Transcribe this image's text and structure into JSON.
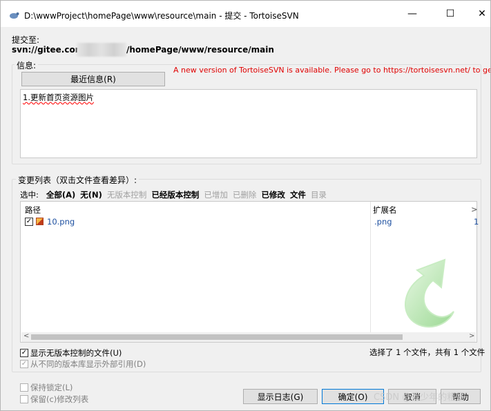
{
  "window": {
    "title": "D:\\wwwProject\\homePage\\www\\resource\\main - 提交 - TortoiseSVN",
    "minimize_glyph": "—",
    "maximize_glyph": "☐",
    "close_glyph": "✕"
  },
  "commit_to": {
    "label": "提交至:",
    "url_prefix": "svn://gitee.com/",
    "url_suffix": "/homePage/www/resource/main"
  },
  "message": {
    "group_label": "信息:",
    "recent_button": "最近信息(R)",
    "update_notice": "A new version of TortoiseSVN is available. Please go to https://tortoisesvn.net/ to get it.",
    "text": "1.更新首页资源图片"
  },
  "changes": {
    "group_label": "变更列表（双击文件查看差异）:",
    "select_label": "选中:",
    "filters": [
      {
        "label": "全部(A)",
        "enabled": true
      },
      {
        "label": "无(N)",
        "enabled": true
      },
      {
        "label": "无版本控制",
        "enabled": false
      },
      {
        "label": "已经版本控制",
        "enabled": true
      },
      {
        "label": "已增加",
        "enabled": false
      },
      {
        "label": "已删除",
        "enabled": false
      },
      {
        "label": "已修改",
        "enabled": true
      },
      {
        "label": "文件",
        "enabled": true
      },
      {
        "label": "目录",
        "enabled": false
      }
    ],
    "columns": {
      "path": "路径",
      "extension": "扩展名",
      "more": ">"
    },
    "files": [
      {
        "checked": true,
        "name": "10.png",
        "extension": ".png",
        "extra": "1"
      }
    ]
  },
  "options": {
    "show_unversioned": {
      "label": "显示无版本控制的文件(U)",
      "checked": true
    },
    "show_externals": {
      "label": "从不同的版本库显示外部引用(D)",
      "checked": true
    },
    "keep_locks": {
      "label": "保持锁定(L)",
      "checked": false
    },
    "keep_changelists": {
      "label": "保留(c)修改列表",
      "checked": false
    }
  },
  "selection_status": "选择了 1 个文件，共有 1 个文件",
  "buttons": {
    "show_log": "显示日志(G)",
    "ok": "确定(O)",
    "cancel": "取消",
    "help": "帮助"
  },
  "watermark": "CSDN @我少年的粗暴",
  "colors": {
    "update_notice": "#e00000",
    "file_link": "#1e50a0",
    "svn_arrow": "#a8e0a0"
  }
}
